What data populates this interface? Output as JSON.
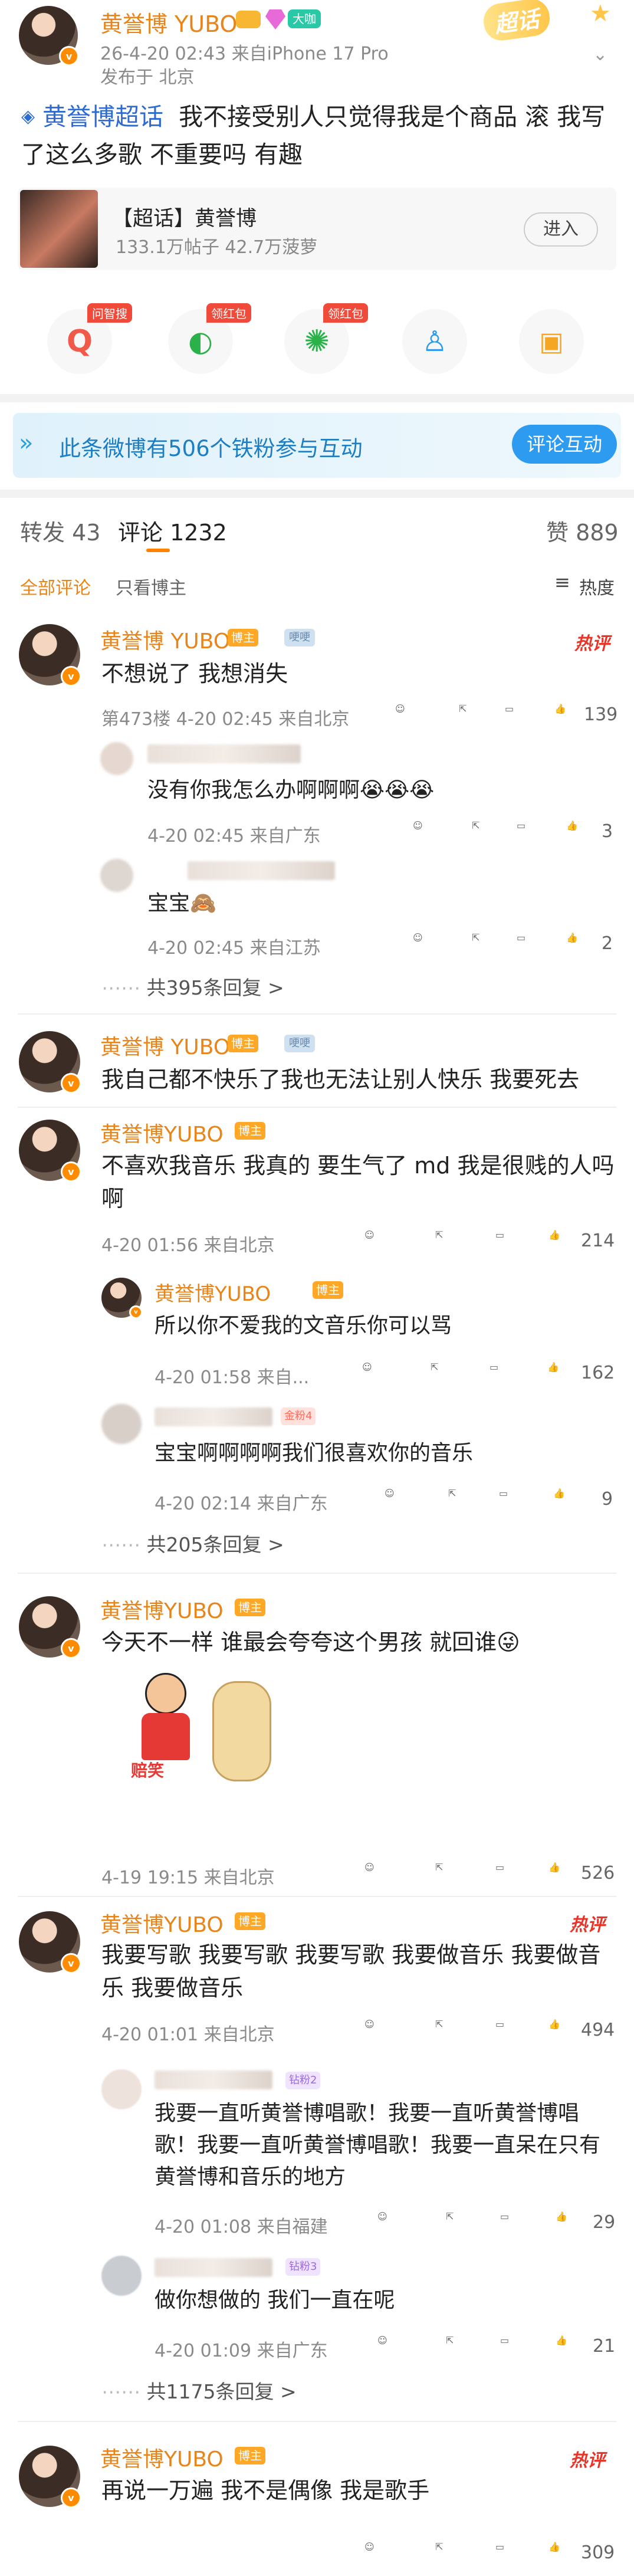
{
  "post": {
    "author": "黄誉博 YUBO",
    "level_badge": "大咖",
    "sticker": "超话",
    "meta_line": "26-4-20 02:43 来自iPhone 17 Pro",
    "location": "发布于 北京",
    "supertopic_link": "黄誉博超话",
    "body": "我不接受别人只觉得我是个商品 滚 我写了这么多歌 不重要吗 有趣",
    "supertopic_card": {
      "title": "【超话】黄誉博",
      "stats": "133.1万帖子 42.7万菠萝",
      "button": "进入"
    },
    "actions": [
      {
        "icon": "smart-search-icon",
        "tag": "问智搜"
      },
      {
        "icon": "wechat-icon",
        "tag": "领红包"
      },
      {
        "icon": "camera-lens-icon",
        "tag": "领红包"
      },
      {
        "icon": "qq-icon",
        "tag": ""
      },
      {
        "icon": "image-save-icon",
        "tag": ""
      }
    ],
    "fan_banner": {
      "text": "此条微博有506个铁粉参与互动",
      "button": "评论互动"
    }
  },
  "tabs": {
    "repost": "转发 43",
    "comment": "评论 1232",
    "like": "赞 889"
  },
  "filters": {
    "all": "全部评论",
    "author_only": "只看博主",
    "sort": "热度"
  },
  "colors": {
    "accent": "#e8851a",
    "link": "#2e6bd0",
    "hot": "#e8352a"
  },
  "comments": [
    {
      "name": "黄誉博 YUBO",
      "tag": "博主",
      "level": "哽哽",
      "hot": "热评",
      "text": "不想说了 我想消失",
      "meta": "第473楼 4-20 02:45 来自北京",
      "likes": "139",
      "replies": [
        {
          "text": "没有你我怎么办啊啊啊😭😭😭",
          "meta": "4-20 02:45 来自广东",
          "likes": "3"
        },
        {
          "text": "宝宝🙈",
          "meta": "4-20 02:45 来自江苏",
          "likes": "2"
        }
      ],
      "more": "共395条回复 >"
    },
    {
      "name": "黄誉博 YUBO",
      "tag": "博主",
      "level": "哽哽",
      "text": "我自己都不快乐了我也无法让别人快乐 我要死去"
    },
    {
      "name": "黄誉博YUBO",
      "tag": "博主",
      "text": "不喜欢我音乐 我真的 要生气了 md 我是很贱的人吗啊",
      "meta": "4-20 01:56 来自北京",
      "likes": "214",
      "replies": [
        {
          "name": "黄誉博YUBO",
          "tag": "博主",
          "text": "所以你不爱我的文音乐你可以骂",
          "meta": "4-20 01:58 来自...",
          "likes": "162"
        },
        {
          "fans": "金粉4",
          "text": "宝宝啊啊啊啊我们很喜欢你的音乐",
          "meta": "4-20 02:14 来自广东",
          "likes": "9"
        }
      ],
      "more": "共205条回复 >"
    },
    {
      "name": "黄誉博YUBO",
      "tag": "博主",
      "text": "今天不一样 谁最会夸夸这个男孩 就回谁😜",
      "sticker_label": "赔笑",
      "meta": "4-19 19:15 来自北京",
      "likes": "526"
    },
    {
      "name": "黄誉博YUBO",
      "tag": "博主",
      "hot": "热评",
      "text": "我要写歌 我要写歌 我要写歌 我要做音乐 我要做音乐 我要做音乐",
      "meta": "4-20 01:01 来自北京",
      "likes": "494",
      "replies": [
        {
          "fans": "钻粉2",
          "text": "我要一直听黄誉博唱歌！我要一直听黄誉博唱歌！我要一直听黄誉博唱歌！我要一直呆在只有黄誉博和音乐的地方",
          "meta": "4-20 01:08 来自福建",
          "likes": "29"
        },
        {
          "fans": "钻粉3",
          "text": "做你想做的 我们一直在呢",
          "meta": "4-20 01:09 来自广东",
          "likes": "21"
        }
      ],
      "more": "共1175条回复 >"
    },
    {
      "name": "黄誉博YUBO",
      "tag": "博主",
      "hot": "热评",
      "text": "再说一万遍 我不是偶像 我是歌手",
      "likes": "309"
    }
  ]
}
